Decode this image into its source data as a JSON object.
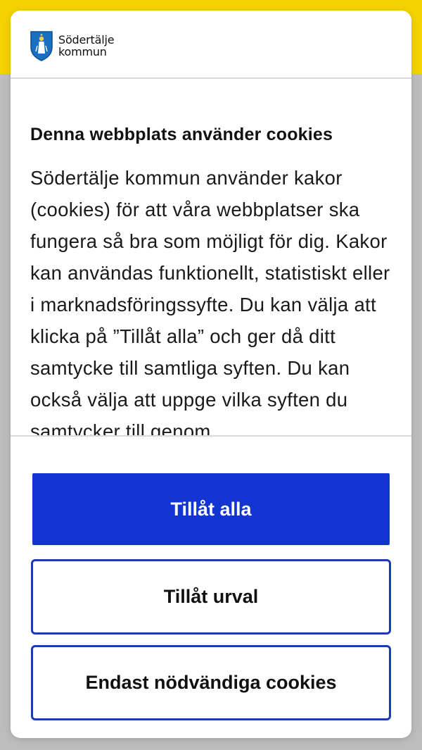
{
  "brand": {
    "name_line1": "Södertälje",
    "name_line2": "kommun",
    "logo_icon": "shield-icon"
  },
  "colors": {
    "backdrop_yellow": "#f5d300",
    "primary_button": "#1234d0",
    "outline_border": "#1b3bb4"
  },
  "cookie_dialog": {
    "title": "Denna webbplats använder cookies",
    "text": "Södertälje kommun använder kakor (cookies) för att våra webbplatser ska fungera så bra som möjligt för dig. Kakor kan användas funktionellt, statistiskt eller i marknadsföringssyfte. Du kan välja att klicka på ”Tillåt alla” och ger då ditt samtycke till samtliga syften. Du kan också välja att uppge vilka syften du samtycker till genom"
  },
  "buttons": {
    "allow_all": "Tillåt alla",
    "allow_selection": "Tillåt urval",
    "necessary_only": "Endast nödvändiga cookies"
  }
}
